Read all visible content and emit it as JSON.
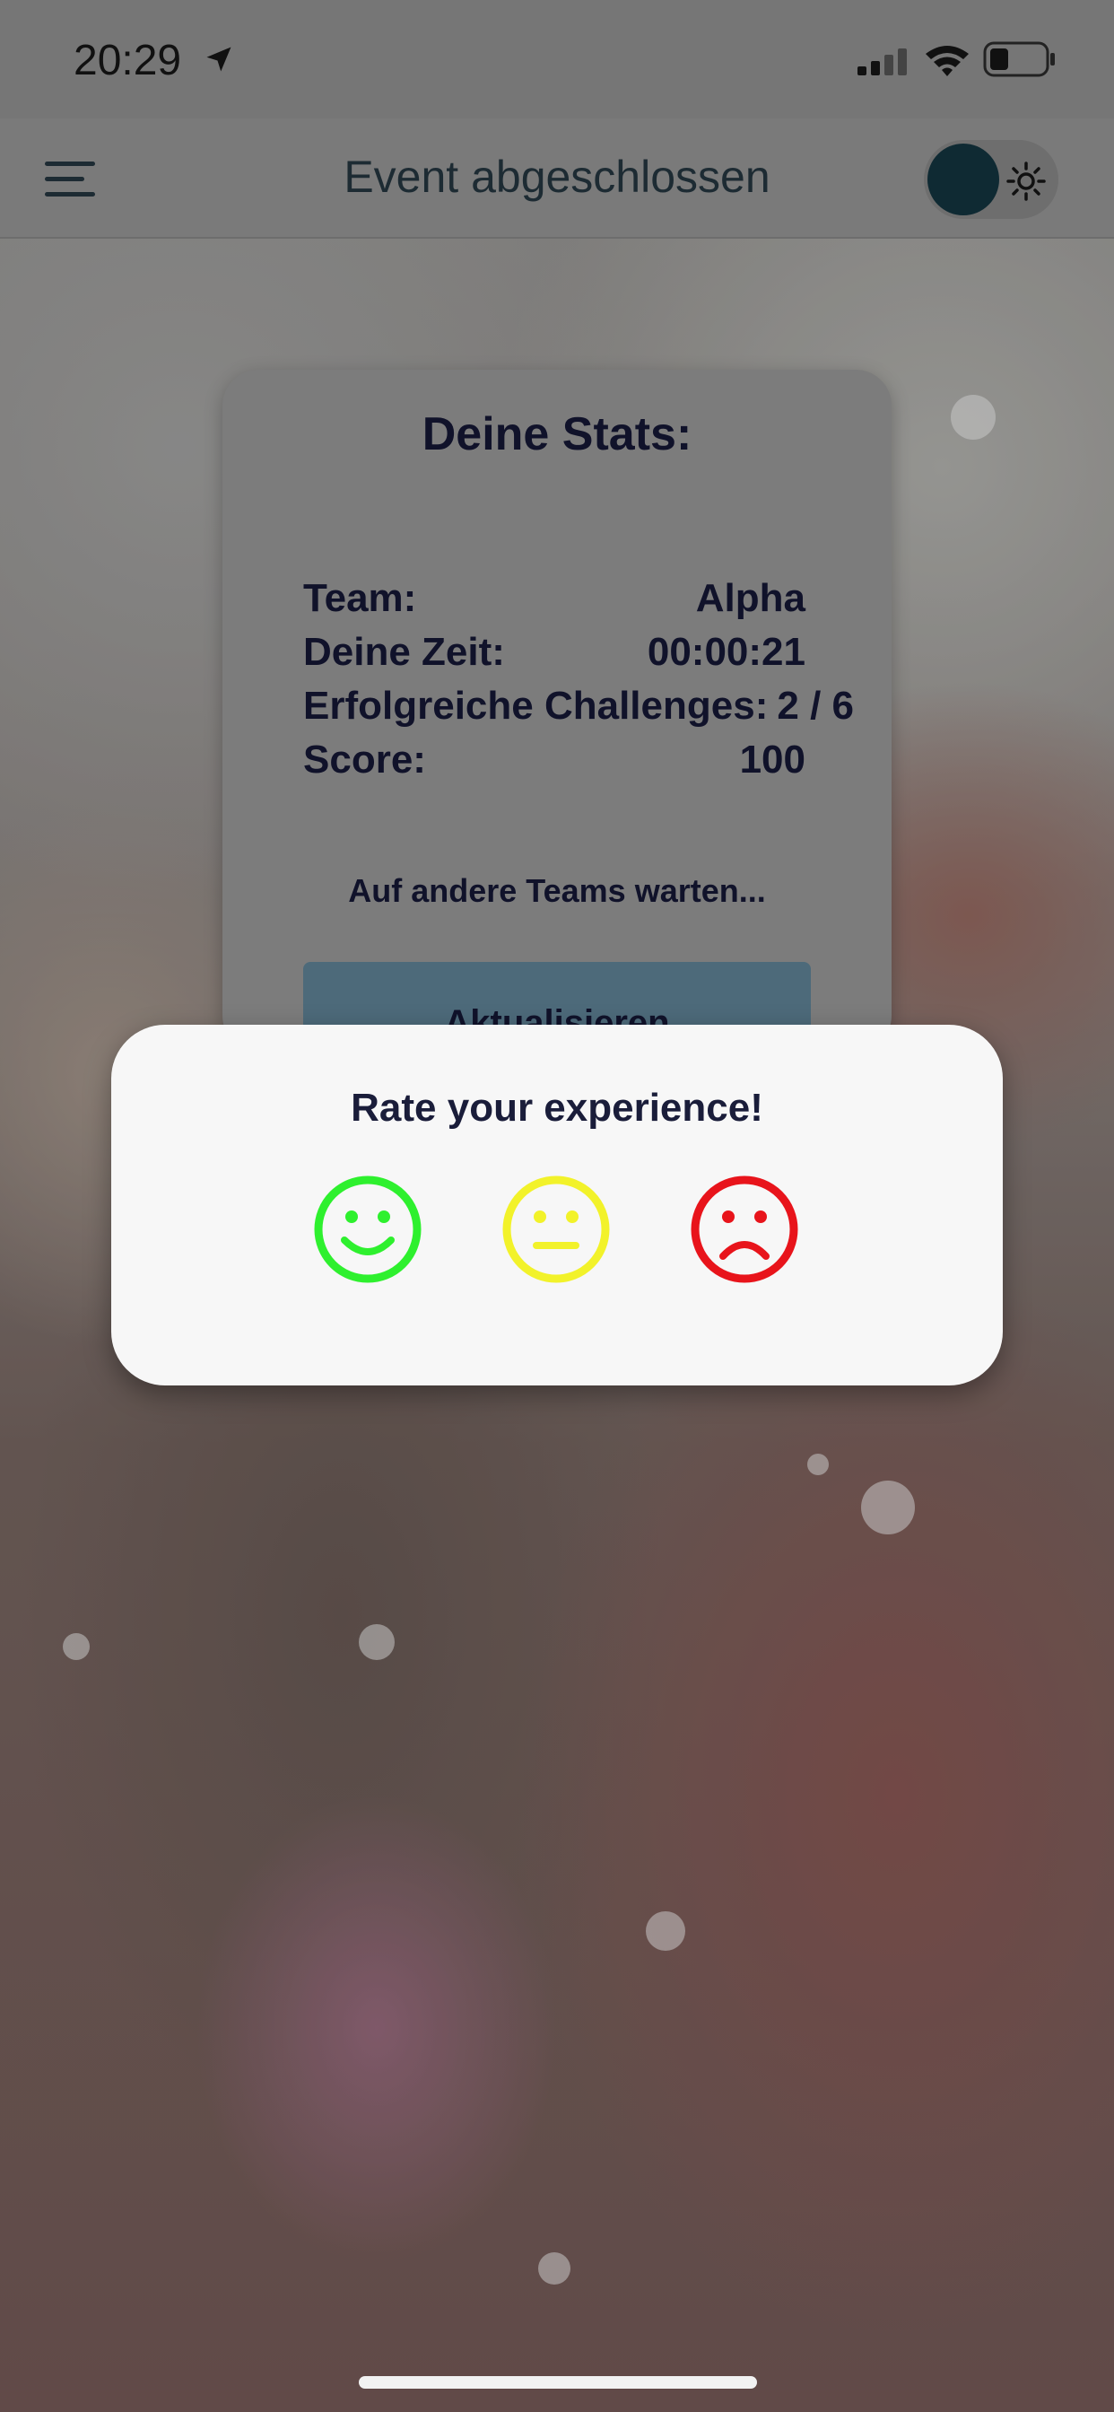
{
  "status_bar": {
    "time": "20:29",
    "location_icon": "location-arrow-icon",
    "signal_icon": "cellular-signal-icon",
    "wifi_icon": "wifi-icon",
    "battery_icon": "battery-icon"
  },
  "nav": {
    "menu_icon": "hamburger-menu-icon",
    "title": "Event abgeschlossen",
    "theme_toggle_icon": "sun-icon"
  },
  "stats": {
    "title": "Deine Stats:",
    "rows": [
      {
        "label": "Team:",
        "value": "Alpha"
      },
      {
        "label": "Deine Zeit:",
        "value": "00:00:21"
      },
      {
        "label": "Erfolgreiche Challenges:",
        "value": "2 / 6"
      },
      {
        "label": "Score:",
        "value": "100"
      }
    ],
    "waiting_text": "Auf andere Teams warten...",
    "refresh_label": "Aktualisieren"
  },
  "rating": {
    "title": "Rate your experience!",
    "options": [
      {
        "name": "happy",
        "icon": "happy-face-icon",
        "color": "#2ef02e"
      },
      {
        "name": "neutral",
        "icon": "neutral-face-icon",
        "color": "#f2f22a"
      },
      {
        "name": "sad",
        "icon": "sad-face-icon",
        "color": "#e8141b"
      }
    ]
  },
  "colors": {
    "text_dark": "#10122a",
    "modal_bg": "#f7f7f7",
    "button": "#4d6a7a"
  }
}
